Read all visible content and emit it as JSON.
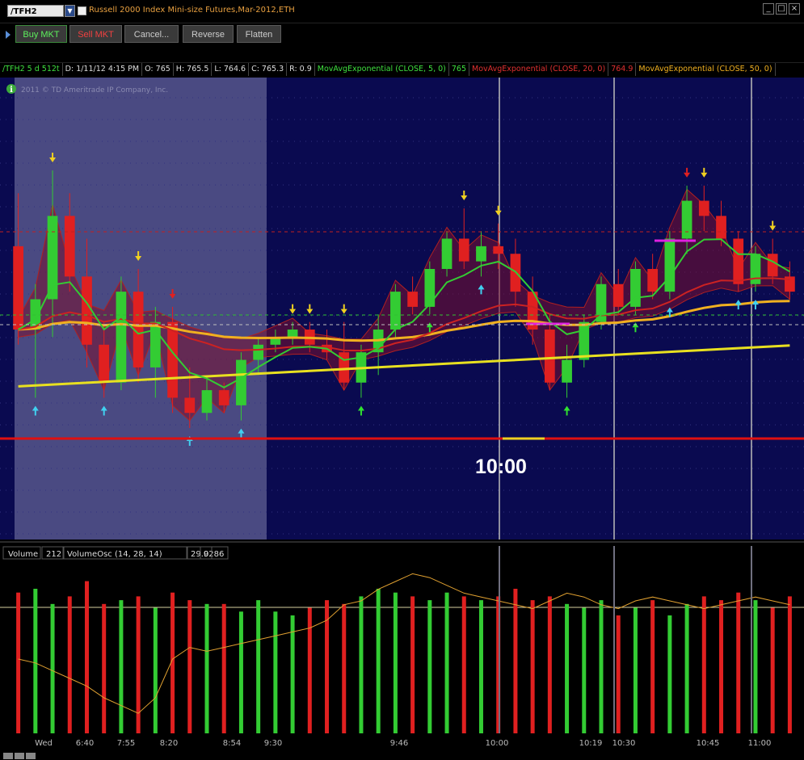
{
  "window": {
    "symbol": "/TFH2",
    "title": "Russell 2000 Index Mini-size Futures,Mar-2012,ETH"
  },
  "order_buttons": {
    "buy": "Buy MKT",
    "sell": "Sell MKT",
    "cancel": "Cancel...",
    "reverse": "Reverse",
    "flatten": "Flatten"
  },
  "info": {
    "symbol_period": "/TFH2 5 d 512t",
    "date": "D: 1/11/12 4:15 PM",
    "open": "O: 765",
    "high": "H: 765.5",
    "low": "L: 764.6",
    "close": "C: 765.3",
    "range": "R: 0.9",
    "ema5": "MovAvgExponential (CLOSE, 5, 0)",
    "ema5_val": "765",
    "ema20": "MovAvgExponential (CLOSE, 20, 0)",
    "ema20_val": "764.9",
    "ema50": "MovAvgExponential (CLOSE, 50, 0)"
  },
  "copyright": "2011 © TD Ameritrade IP Company, Inc.",
  "annotation": "10:00",
  "volume_header": {
    "label": "Volume",
    "value": "212",
    "osc": "VolumeOsc (14, 28, 14)",
    "osc_val": "29.9286",
    "zero": "0"
  },
  "time_axis": [
    "Wed",
    "6:40",
    "7:55",
    "8:20",
    "8:54",
    "9:30",
    "9:46",
    "10:00",
    "10:19",
    "10:30",
    "10:45",
    "11:00"
  ],
  "colors": {
    "background": "#0a0a50",
    "premarket_shade": "#4a4a82",
    "up": "#33cc33",
    "down": "#e02020",
    "ema5": "#33cc33",
    "ema20": "#cc2222",
    "ema50": "#f0b020",
    "ema_long": "#e8e020",
    "support": "#e01010"
  },
  "chart_data": {
    "type": "candlestick",
    "candles": [
      {
        "o": 765.2,
        "h": 765.9,
        "l": 763.9,
        "c": 764.1
      },
      {
        "o": 764.1,
        "h": 764.7,
        "l": 763.2,
        "c": 764.5
      },
      {
        "o": 764.5,
        "h": 766.2,
        "l": 764.0,
        "c": 765.6
      },
      {
        "o": 765.6,
        "h": 765.9,
        "l": 764.6,
        "c": 764.8
      },
      {
        "o": 764.8,
        "h": 765.3,
        "l": 763.6,
        "c": 763.9
      },
      {
        "o": 763.9,
        "h": 764.2,
        "l": 763.2,
        "c": 763.4
      },
      {
        "o": 763.4,
        "h": 764.8,
        "l": 763.3,
        "c": 764.6
      },
      {
        "o": 764.6,
        "h": 764.9,
        "l": 763.4,
        "c": 763.6
      },
      {
        "o": 763.6,
        "h": 764.4,
        "l": 763.2,
        "c": 764.2
      },
      {
        "o": 764.2,
        "h": 764.4,
        "l": 763.0,
        "c": 763.2
      },
      {
        "o": 763.2,
        "h": 763.6,
        "l": 762.8,
        "c": 763.0
      },
      {
        "o": 763.0,
        "h": 763.5,
        "l": 762.9,
        "c": 763.3
      },
      {
        "o": 763.3,
        "h": 763.4,
        "l": 763.0,
        "c": 763.1
      },
      {
        "o": 763.1,
        "h": 763.8,
        "l": 762.9,
        "c": 763.7
      },
      {
        "o": 763.7,
        "h": 764.0,
        "l": 763.5,
        "c": 763.9
      },
      {
        "o": 763.9,
        "h": 764.1,
        "l": 763.8,
        "c": 764.0
      },
      {
        "o": 764.0,
        "h": 764.2,
        "l": 763.9,
        "c": 764.1
      },
      {
        "o": 764.1,
        "h": 764.2,
        "l": 763.8,
        "c": 763.9
      },
      {
        "o": 763.9,
        "h": 764.1,
        "l": 763.7,
        "c": 763.8
      },
      {
        "o": 763.8,
        "h": 764.2,
        "l": 763.3,
        "c": 763.4
      },
      {
        "o": 763.4,
        "h": 763.9,
        "l": 763.2,
        "c": 763.8
      },
      {
        "o": 763.8,
        "h": 764.3,
        "l": 763.5,
        "c": 764.1
      },
      {
        "o": 764.1,
        "h": 764.7,
        "l": 764.0,
        "c": 764.6
      },
      {
        "o": 764.6,
        "h": 764.8,
        "l": 764.3,
        "c": 764.4
      },
      {
        "o": 764.4,
        "h": 765.0,
        "l": 764.3,
        "c": 764.9
      },
      {
        "o": 764.9,
        "h": 765.4,
        "l": 764.8,
        "c": 765.3
      },
      {
        "o": 765.3,
        "h": 765.7,
        "l": 764.9,
        "c": 765.0
      },
      {
        "o": 765.0,
        "h": 765.4,
        "l": 764.8,
        "c": 765.2
      },
      {
        "o": 765.2,
        "h": 765.5,
        "l": 764.9,
        "c": 765.1
      },
      {
        "o": 765.1,
        "h": 765.3,
        "l": 764.4,
        "c": 764.6
      },
      {
        "o": 764.6,
        "h": 764.8,
        "l": 763.9,
        "c": 764.1
      },
      {
        "o": 764.1,
        "h": 764.3,
        "l": 763.3,
        "c": 763.4
      },
      {
        "o": 763.4,
        "h": 763.9,
        "l": 763.2,
        "c": 763.7
      },
      {
        "o": 763.7,
        "h": 764.3,
        "l": 763.6,
        "c": 764.2
      },
      {
        "o": 764.2,
        "h": 764.8,
        "l": 764.1,
        "c": 764.7
      },
      {
        "o": 764.7,
        "h": 764.9,
        "l": 764.3,
        "c": 764.4
      },
      {
        "o": 764.4,
        "h": 765.0,
        "l": 764.3,
        "c": 764.9
      },
      {
        "o": 764.9,
        "h": 765.1,
        "l": 764.5,
        "c": 764.6
      },
      {
        "o": 764.6,
        "h": 765.4,
        "l": 764.5,
        "c": 765.3
      },
      {
        "o": 765.3,
        "h": 766.0,
        "l": 765.1,
        "c": 765.8
      },
      {
        "o": 765.8,
        "h": 766.0,
        "l": 765.4,
        "c": 765.6
      },
      {
        "o": 765.6,
        "h": 765.8,
        "l": 765.2,
        "c": 765.3
      },
      {
        "o": 765.3,
        "h": 765.4,
        "l": 764.6,
        "c": 764.7
      },
      {
        "o": 764.7,
        "h": 765.2,
        "l": 764.6,
        "c": 765.1
      },
      {
        "o": 765.1,
        "h": 765.3,
        "l": 764.7,
        "c": 764.8
      },
      {
        "o": 764.8,
        "h": 765.0,
        "l": 764.5,
        "c": 764.6
      }
    ],
    "volume": [
      74,
      76,
      68,
      72,
      80,
      68,
      70,
      72,
      66,
      74,
      70,
      68,
      68,
      64,
      70,
      64,
      62,
      66,
      70,
      68,
      72,
      76,
      74,
      72,
      70,
      74,
      72,
      70,
      72,
      76,
      70,
      72,
      68,
      66,
      70,
      62,
      66,
      70,
      62,
      68,
      72,
      70,
      74,
      70,
      66,
      72
    ],
    "volume_osc": [
      30,
      28,
      24,
      20,
      16,
      10,
      6,
      2,
      10,
      30,
      36,
      34,
      36,
      38,
      40,
      42,
      44,
      46,
      50,
      58,
      60,
      66,
      70,
      74,
      72,
      68,
      64,
      62,
      60,
      58,
      56,
      60,
      64,
      62,
      58,
      56,
      60,
      62,
      60,
      58,
      56,
      58,
      60,
      62,
      60,
      58
    ]
  }
}
